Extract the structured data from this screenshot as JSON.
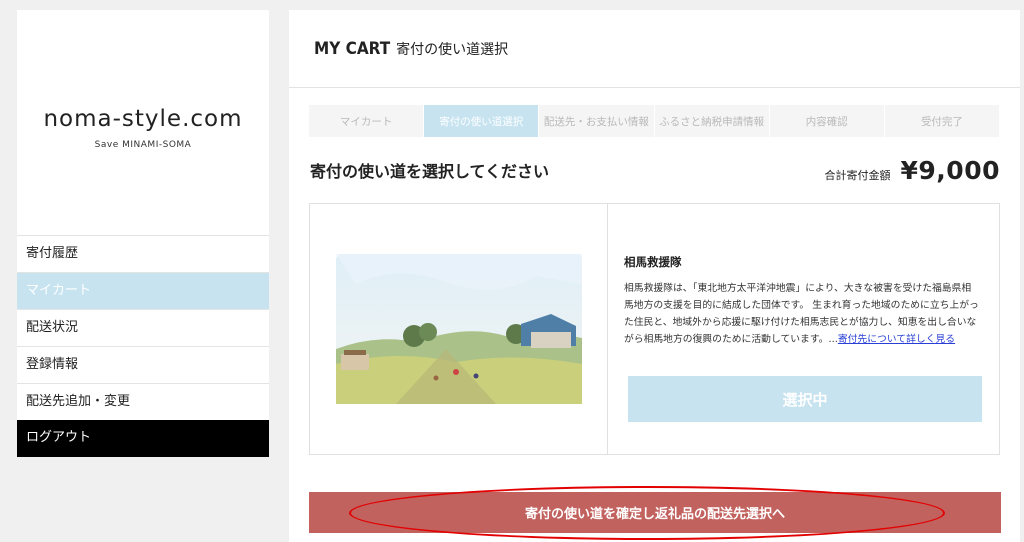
{
  "sidebar": {
    "logo": "noma-style.com",
    "tagline": "Save MINAMI-SOMA",
    "items": [
      {
        "label": "寄付履歴"
      },
      {
        "label": "マイカート"
      },
      {
        "label": "配送状況"
      },
      {
        "label": "登録情報"
      },
      {
        "label": "配送先追加・変更"
      },
      {
        "label": "ログアウト"
      }
    ]
  },
  "header": {
    "title_en": "MY CART",
    "title_ja": "寄付の使い道選択"
  },
  "steps": [
    {
      "label": "マイカート"
    },
    {
      "label": "寄付の使い道選択"
    },
    {
      "label": "配送先・お支払い情報"
    },
    {
      "label": "ふるさと納税申請情報"
    },
    {
      "label": "内容確認"
    },
    {
      "label": "受付完了"
    }
  ],
  "section_title": "寄付の使い道を選択してください",
  "total": {
    "label": "合計寄付金額",
    "value": "¥9,000"
  },
  "card": {
    "name": "相馬救援隊",
    "description": "相馬救援隊は、「東北地方太平洋沖地震」により、大きな被害を受けた福島県相馬地方の支援を目的に結成した団体です。 生まれ育った地域のために立ち上がった住民と、地域外から応援に駆け付けた相馬志民とが協力し、知恵を出し合いながら相馬地方の復興のために活動しています。...",
    "link_text": "寄付先について詳しく見る",
    "select_label": "選択中"
  },
  "confirm_label": "寄付の使い道を確定し返礼品の配送先選択へ",
  "colors": {
    "active_tab": "#c7e3f0",
    "confirm_button": "#c2625f",
    "highlight": "#e20000"
  }
}
